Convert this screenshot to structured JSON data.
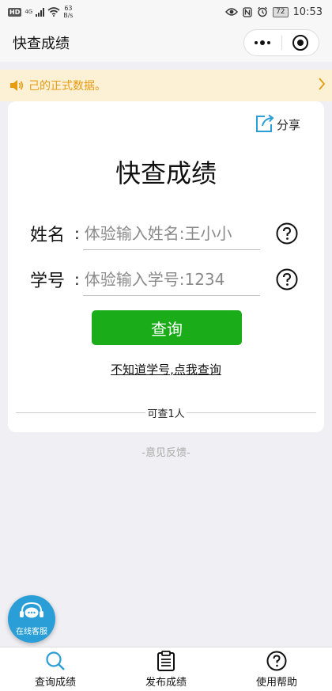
{
  "status_bar": {
    "hd": "HD",
    "network": "4G",
    "speed_value": "63",
    "speed_unit": "B/s",
    "battery": "72",
    "time": "10:53"
  },
  "nav": {
    "title": "快查成绩"
  },
  "notice": {
    "text": "己的正式数据。"
  },
  "card": {
    "share_label": "分享",
    "title": "快查成绩",
    "name_label": "姓名",
    "name_placeholder": "体验输入姓名:王小小",
    "id_label": "学号",
    "id_placeholder": "体验输入学号:1234",
    "colon": ":",
    "query_button": "查询",
    "forgot_link": "不知道学号,点我查询",
    "quota_text": "可查1人"
  },
  "feedback": "-意见反馈-",
  "service_label": "在线客服",
  "tabs": [
    {
      "label": "查询成绩",
      "icon": "search-icon"
    },
    {
      "label": "发布成绩",
      "icon": "clipboard-icon"
    },
    {
      "label": "使用帮助",
      "icon": "help-icon"
    }
  ],
  "colors": {
    "primary_green": "#1aad19",
    "notice_bg": "#fdf1d5",
    "notice_text": "#e69b11",
    "share_blue": "#2a9ed6",
    "service_blue": "#2a9ed6"
  }
}
